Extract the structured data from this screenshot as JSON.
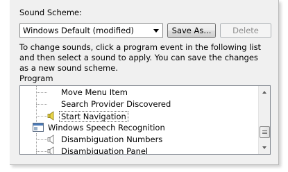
{
  "sound_scheme": {
    "label": "Sound Scheme:",
    "selected": "Windows Default (modified)",
    "save_as_label": "Save As...",
    "delete_label": "Delete"
  },
  "description": "To change sounds, click a program event in the following list and then select a sound to apply.  You can save the changes as a new sound scheme.",
  "program": {
    "label": "Program",
    "items": [
      {
        "label": "Move Menu Item",
        "type": "event",
        "has_sound": false
      },
      {
        "label": "Search Provider Discovered",
        "type": "event",
        "has_sound": false
      },
      {
        "label": "Start Navigation",
        "type": "event",
        "has_sound": true,
        "selected": true
      },
      {
        "label": "Windows Speech Recognition",
        "type": "group"
      },
      {
        "label": "Disambiguation Numbers",
        "type": "event",
        "has_sound": false
      },
      {
        "label": "Disambiguation Panel",
        "type": "event",
        "has_sound": false
      }
    ]
  },
  "colors": {
    "window_bg": "#f0f0f0",
    "speaker_active": "#e8d44a",
    "speaker_inactive": "#9a9a9a"
  }
}
